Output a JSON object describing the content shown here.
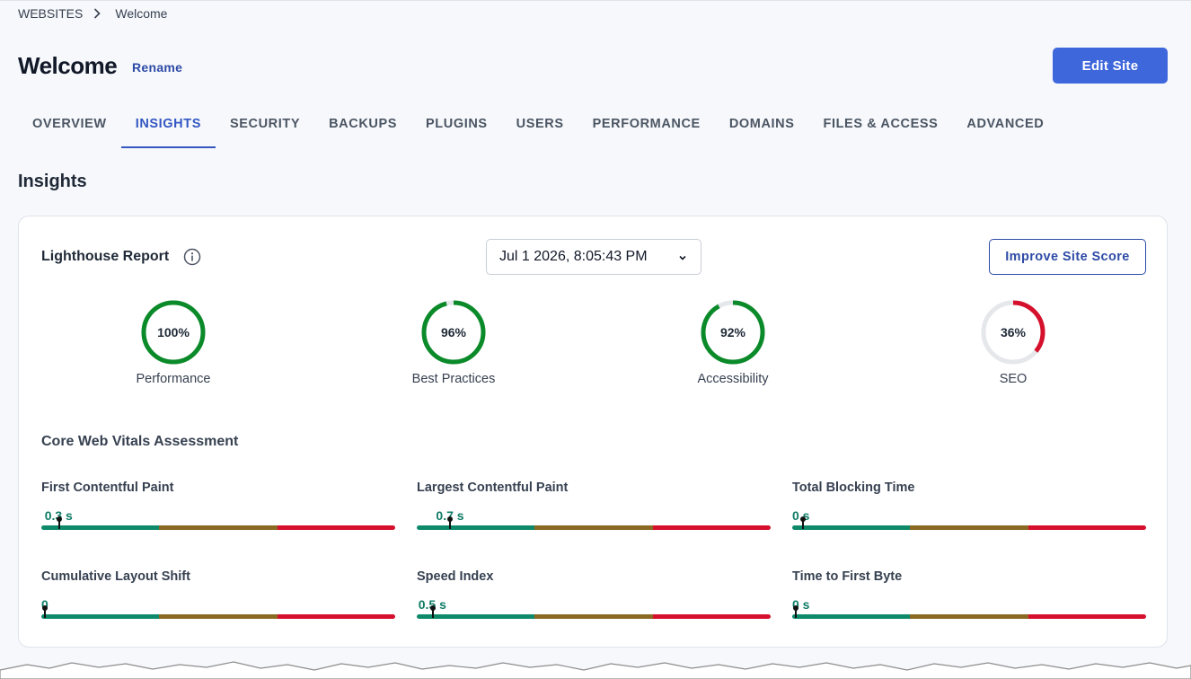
{
  "breadcrumb": {
    "root": "WEBSITES",
    "current": "Welcome"
  },
  "header": {
    "title": "Welcome",
    "rename_label": "Rename",
    "edit_label": "Edit Site"
  },
  "tabs": [
    {
      "label": "OVERVIEW",
      "active": false
    },
    {
      "label": "INSIGHTS",
      "active": true
    },
    {
      "label": "SECURITY",
      "active": false
    },
    {
      "label": "BACKUPS",
      "active": false
    },
    {
      "label": "PLUGINS",
      "active": false
    },
    {
      "label": "USERS",
      "active": false
    },
    {
      "label": "PERFORMANCE",
      "active": false
    },
    {
      "label": "DOMAINS",
      "active": false
    },
    {
      "label": "FILES & ACCESS",
      "active": false
    },
    {
      "label": "ADVANCED",
      "active": false
    }
  ],
  "section_title": "Insights",
  "report": {
    "title": "Lighthouse Report",
    "date": "Jul 1 2026, 8:05:43 PM",
    "improve_label": "Improve Site Score",
    "gauges": [
      {
        "label": "Performance",
        "value": 100,
        "text": "100%",
        "color": "#0b8a2a"
      },
      {
        "label": "Best Practices",
        "value": 96,
        "text": "96%",
        "color": "#0b8a2a"
      },
      {
        "label": "Accessibility",
        "value": 92,
        "text": "92%",
        "color": "#0b8a2a"
      },
      {
        "label": "SEO",
        "value": 36,
        "text": "36%",
        "color": "#d5102c"
      }
    ]
  },
  "cwv": {
    "title": "Core Web Vitals Assessment",
    "metrics": [
      {
        "name": "First Contentful Paint",
        "value": "0.3 s",
        "position": 0.05
      },
      {
        "name": "Largest Contentful Paint",
        "value": "0.7 s",
        "position": 0.095
      },
      {
        "name": "Total Blocking Time",
        "value": "0 s",
        "position": 0.03
      },
      {
        "name": "Cumulative Layout Shift",
        "value": "0",
        "position": 0.01
      },
      {
        "name": "Speed Index",
        "value": "0.5 s",
        "position": 0.045
      },
      {
        "name": "Time to First Byte",
        "value": "0 s",
        "position": 0.01
      }
    ]
  },
  "colors": {
    "accent": "#3f67dc",
    "link": "#2e4ba6",
    "good": "#0e8a6a",
    "average": "#8a6a22",
    "poor": "#d5102c",
    "gauge_track": "#e5e7eb"
  },
  "icons": {
    "breadcrumb_separator": "chevron-right-icon",
    "info": "info-icon",
    "dropdown": "chevron-down-icon"
  }
}
